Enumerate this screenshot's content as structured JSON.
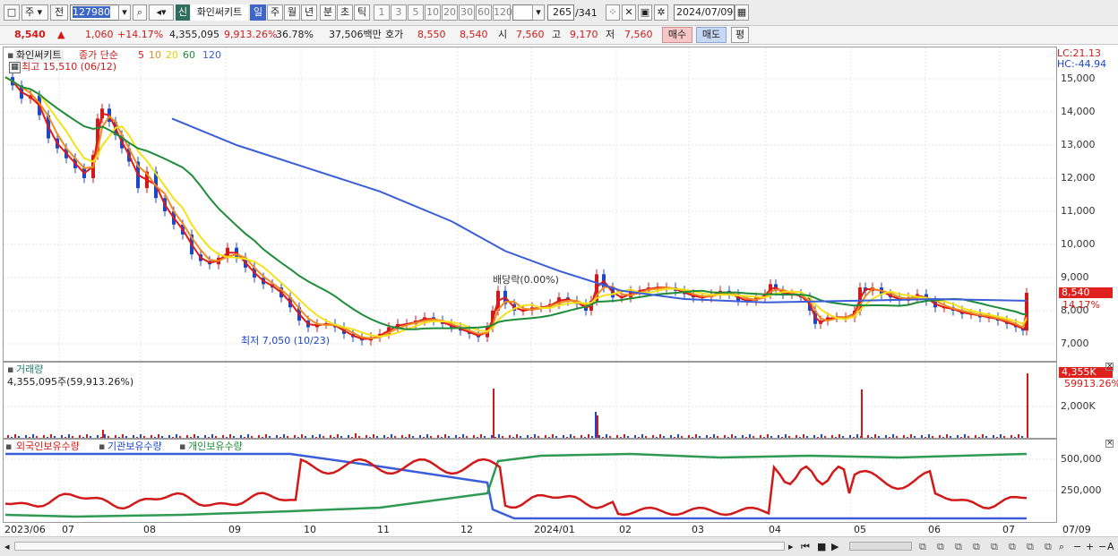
{
  "toolbar": {
    "market": "주",
    "period": "전",
    "code": "127980",
    "new_btn": "신",
    "name": "화인써키트",
    "periods": [
      "일",
      "주",
      "월",
      "년",
      "분",
      "초",
      "틱"
    ],
    "active_period": "일",
    "nums": [
      "1",
      "3",
      "5",
      "10",
      "20",
      "30",
      "60",
      "120"
    ],
    "count": "265",
    "total": "/341",
    "date": "2024/07/09"
  },
  "quote": {
    "price": "8,540",
    "arrow": "▲",
    "change": "1,060",
    "change_pct": "+14.17%",
    "volume": "4,355,095",
    "vol_pct": "9,913.26%",
    "turnover_pct": "36.78%",
    "amount": "37,506백만",
    "hoga_label": "호가",
    "ask": "8,550",
    "bid": "8,540",
    "open_label": "시",
    "open": "7,560",
    "high_label": "고",
    "high": "9,170",
    "low_label": "저",
    "low": "7,560",
    "buy": "매수",
    "sell": "매도",
    "avg": "평"
  },
  "price_pane": {
    "stock": "화인써키트",
    "ma_label": "종가 단순",
    "ma_periods": [
      "5",
      "10",
      "20",
      "60",
      "120"
    ],
    "high_note": "최고 15,510 (06/12)",
    "low_note": "최저 7,050 (10/23)",
    "dividend_note": "배당락(0.00%)",
    "lc": "LC:21.13",
    "hc": "HC:-44.94",
    "current_tag": "8,540",
    "current_pct": "14.17%",
    "y_ticks": [
      "15,000",
      "14,000",
      "13,000",
      "12,000",
      "11,000",
      "10,000",
      "9,000",
      "8,000",
      "7,000"
    ]
  },
  "volume_pane": {
    "title": "거래량",
    "value": "4,355,095주(59,913.26%)",
    "y_tick": "2,000K",
    "tag": "4,355K",
    "tag_pct": "59913.26%"
  },
  "holdings_pane": {
    "tabs": [
      "외국인보유수량",
      "기관보유수량",
      "개인보유수량"
    ],
    "y_ticks": [
      "500,000",
      "250,000"
    ]
  },
  "x_axis": {
    "labels": [
      "2023/06",
      "07",
      "08",
      "09",
      "10",
      "11",
      "12",
      "2024/01",
      "02",
      "03",
      "04",
      "05",
      "06",
      "07"
    ],
    "right": "07/09"
  },
  "colors": {
    "up": "#d21919",
    "down": "#1d47c9",
    "ma5": "#e01818",
    "ma10": "#f08a1e",
    "ma20": "#f2e21a",
    "ma60": "#1e8c3a",
    "ma120": "#3a5ed8"
  }
}
